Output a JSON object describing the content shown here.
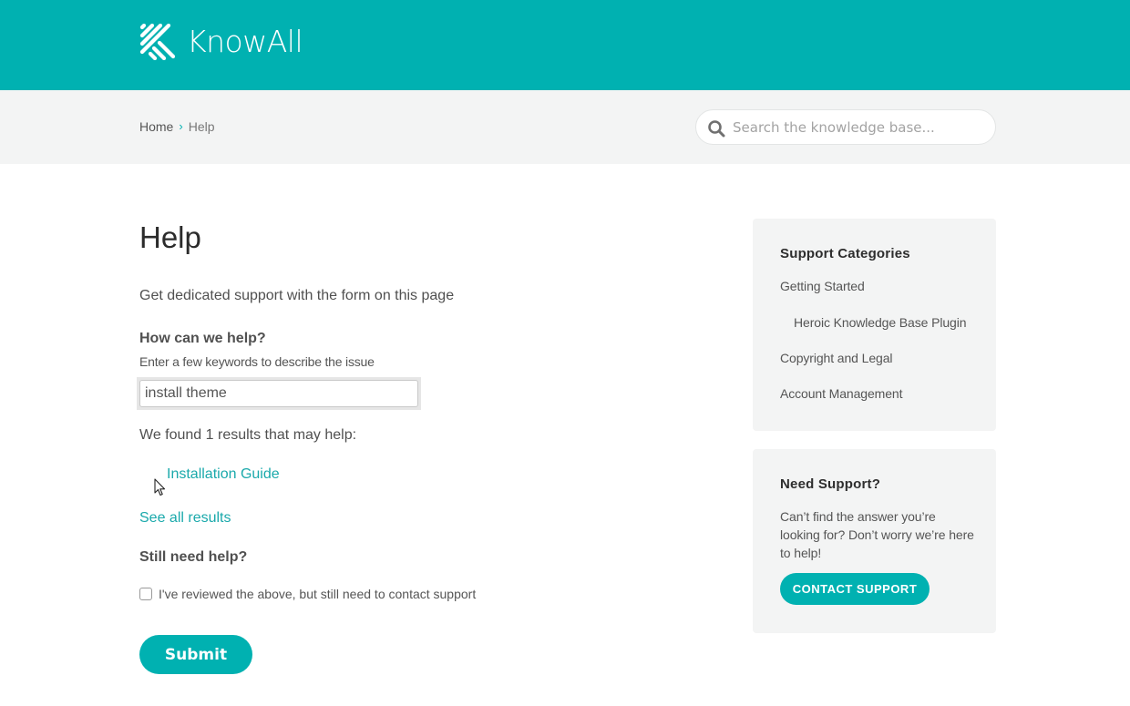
{
  "header": {
    "brand": "KnowAll",
    "logo_icon": "knowall-logo-icon",
    "colors": {
      "brand": "#00b1b1",
      "subheader_bg": "#f3f4f4",
      "link": "#1aa9ab"
    }
  },
  "breadcrumb": {
    "items": [
      {
        "label": "Home"
      },
      {
        "label": "Help"
      }
    ],
    "separator_icon": "chevron-right-icon"
  },
  "search": {
    "placeholder": "Search the knowledge base...",
    "value": "",
    "icon": "search-icon"
  },
  "main": {
    "title": "Help",
    "intro": "Get dedicated support with the form on this page",
    "question": {
      "label": "How can we help?",
      "description": "Enter a few keywords to describe the issue",
      "value": "install theme"
    },
    "results": {
      "summary": "We found 1 results that may help:",
      "items": [
        {
          "label": "Installation Guide"
        }
      ],
      "see_all": "See all results"
    },
    "still_need_help": {
      "title": "Still need help?",
      "checkbox_label": "I've reviewed the above, but still need to contact support",
      "checked": false
    },
    "submit_label": "Submit"
  },
  "sidebar": {
    "categories": {
      "title": "Support Categories",
      "items": [
        {
          "label": "Getting Started",
          "level": 0
        },
        {
          "label": "Heroic Knowledge Base Plugin",
          "level": 1
        },
        {
          "label": "Copyright and Legal",
          "level": 0
        },
        {
          "label": "Account Management",
          "level": 0
        }
      ]
    },
    "support": {
      "title": "Need Support?",
      "text": "Can’t find the answer you’re looking for? Don’t worry we’re here to help!",
      "button_label": "CONTACT SUPPORT"
    }
  }
}
